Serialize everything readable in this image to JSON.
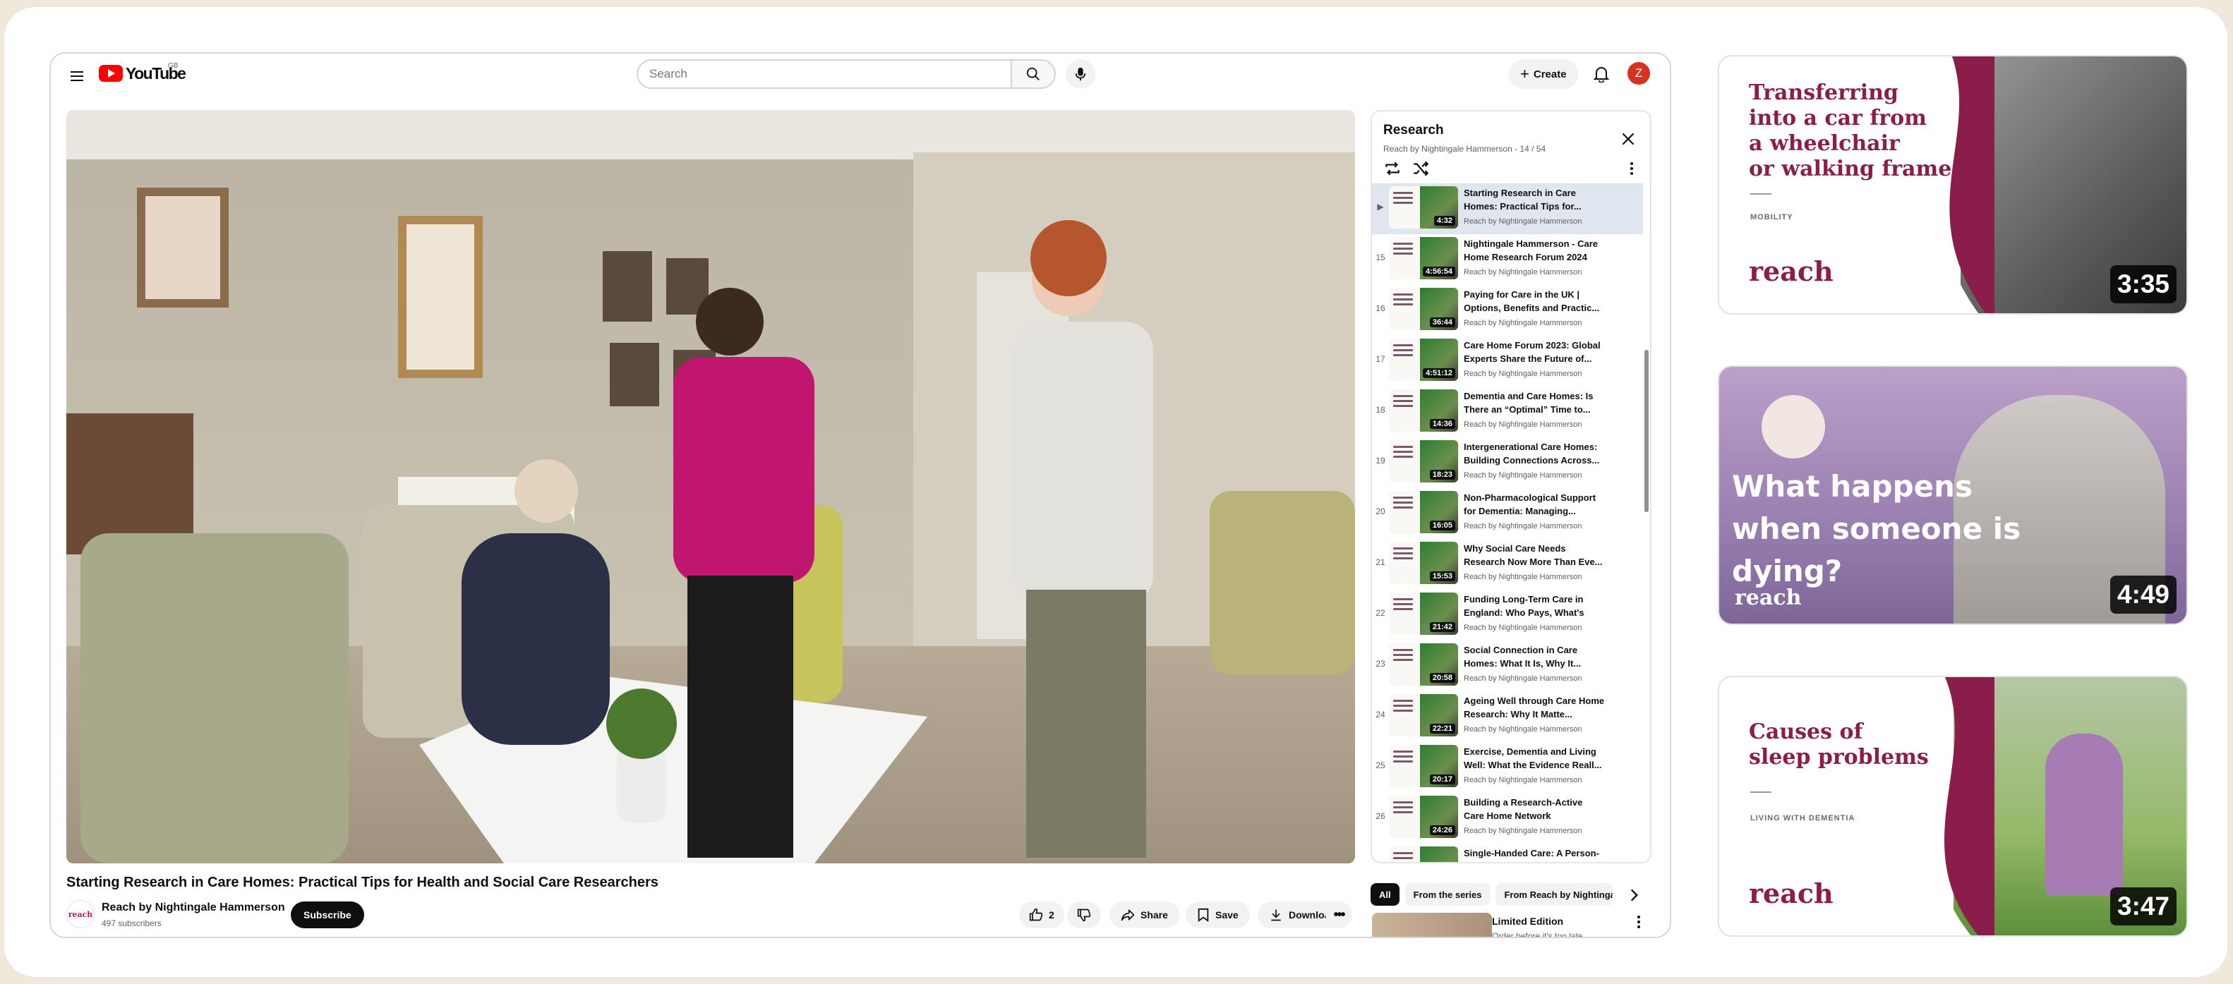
{
  "header": {
    "logo_text": "YouTube",
    "country_code": "GB",
    "search_placeholder": "Search",
    "create_label": "Create",
    "avatar_letter": "Z"
  },
  "video": {
    "title": "Starting Research in Care Homes: Practical Tips for Health and Social Care Researchers",
    "channel_logo_text": "reach",
    "channel_name": "Reach by Nightingale Hammerson",
    "subscribers": "497 subscribers",
    "subscribe_label": "Subscribe",
    "likes": "2",
    "share_label": "Share",
    "save_label": "Save",
    "download_label": "Download"
  },
  "playlist": {
    "title": "Research",
    "subtitle": "Reach by Nightingale Hammerson - 14 / 54",
    "items": [
      {
        "num": "▶",
        "title": "Starting Research in Care Homes: Practical Tips for...",
        "channel": "Reach by Nightingale Hammerson",
        "duration": "4:32",
        "current": true
      },
      {
        "num": "15",
        "title": "Nightingale Hammerson - Care Home Research Forum 2024",
        "channel": "Reach by Nightingale Hammerson",
        "duration": "4:56:54"
      },
      {
        "num": "16",
        "title": "Paying for Care in the UK | Options, Benefits and Practic...",
        "channel": "Reach by Nightingale Hammerson",
        "duration": "36:44"
      },
      {
        "num": "17",
        "title": "Care Home Forum 2023: Global Experts Share the Future of...",
        "channel": "Reach by Nightingale Hammerson",
        "duration": "4:51:12"
      },
      {
        "num": "18",
        "title": "Dementia and Care Homes: Is There an “Optimal” Time to...",
        "channel": "Reach by Nightingale Hammerson",
        "duration": "14:36"
      },
      {
        "num": "19",
        "title": "Intergenerational Care Homes: Building Connections Across...",
        "channel": "Reach by Nightingale Hammerson",
        "duration": "18:23"
      },
      {
        "num": "20",
        "title": "Non-Pharmacological Support for Dementia: Managing...",
        "channel": "Reach by Nightingale Hammerson",
        "duration": "16:05"
      },
      {
        "num": "21",
        "title": "Why Social Care Needs Research Now More Than Eve...",
        "channel": "Reach by Nightingale Hammerson",
        "duration": "15:53"
      },
      {
        "num": "22",
        "title": "Funding Long-Term Care in England: Who Pays, What's Fa...",
        "channel": "Reach by Nightingale Hammerson",
        "duration": "21:42"
      },
      {
        "num": "23",
        "title": "Social Connection in Care Homes: What It Is, Why It...",
        "channel": "Reach by Nightingale Hammerson",
        "duration": "20:58"
      },
      {
        "num": "24",
        "title": "Ageing Well through Care Home Research: Why It Matte...",
        "channel": "Reach by Nightingale Hammerson",
        "duration": "22:21"
      },
      {
        "num": "25",
        "title": "Exercise, Dementia and Living Well: What the Evidence Reall...",
        "channel": "Reach by Nightingale Hammerson",
        "duration": "20:17"
      },
      {
        "num": "26",
        "title": "Building a Research-Active Care Home Network",
        "channel": "Reach by Nightingale Hammerson",
        "duration": "24:26"
      },
      {
        "num": "",
        "title": "Single-Handed Care: A Person-",
        "channel": "",
        "duration": ""
      }
    ]
  },
  "chips": [
    "All",
    "From the series",
    "From Reach by Nightingale Hammerson"
  ],
  "recommended": {
    "title": "Limited Edition",
    "subtitle": "Order before it's too late"
  },
  "cards": [
    {
      "title_lines": [
        "Transferring",
        "into a car from",
        "a wheelchair",
        "or walking frame"
      ],
      "tag": "MOBILITY",
      "logo": "reach",
      "duration": "3:35"
    },
    {
      "title_lines": [
        "What happens",
        "when someone is",
        "dying?"
      ],
      "logo": "reach",
      "duration": "4:49"
    },
    {
      "title_lines": [
        "Causes of",
        "sleep problems"
      ],
      "tag": "LIVING WITH DEMENTIA",
      "logo": "reach",
      "duration": "3:47"
    }
  ]
}
